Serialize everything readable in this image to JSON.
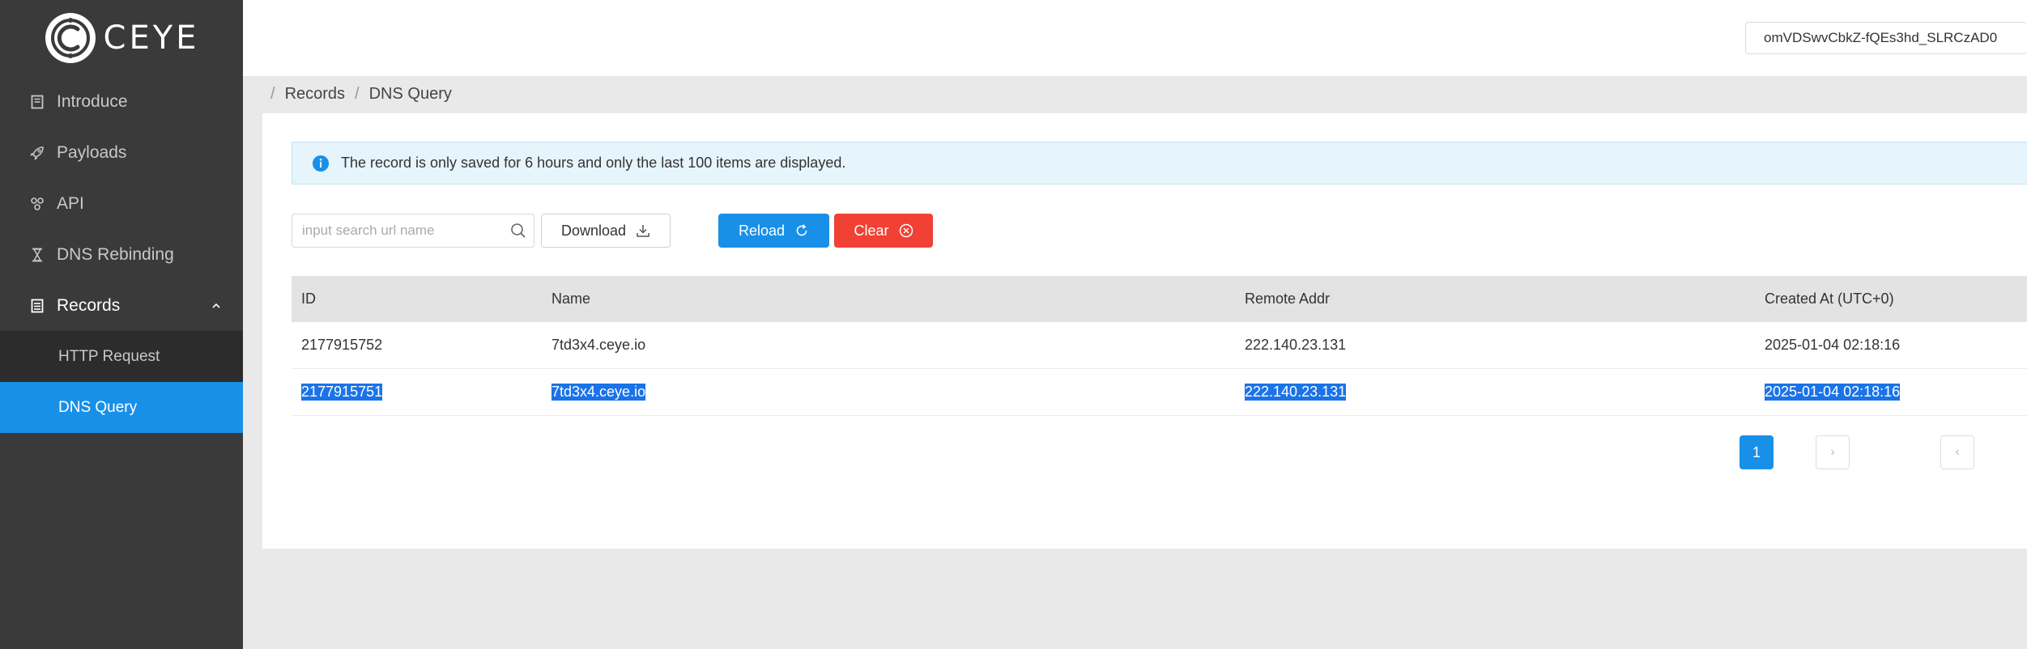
{
  "brand": {
    "name": "CEYE"
  },
  "sidebar": {
    "items": [
      {
        "label": "Introduce",
        "icon": "book-icon"
      },
      {
        "label": "Payloads",
        "icon": "rocket-icon"
      },
      {
        "label": "API",
        "icon": "api-icon"
      },
      {
        "label": "DNS Rebinding",
        "icon": "hourglass-icon"
      },
      {
        "label": "Records",
        "icon": "records-icon"
      }
    ],
    "submenu": [
      {
        "label": "HTTP Request"
      },
      {
        "label": "DNS Query"
      }
    ]
  },
  "header": {
    "account": "omVDSwvCbkZ-fQEs3hd_SLRCzAD0"
  },
  "breadcrumb": {
    "root": "Records",
    "current": "DNS Query"
  },
  "alert": {
    "text": "The record is only saved for 6 hours and only the last 100 items are displayed."
  },
  "toolbar": {
    "search_placeholder": "input search url name",
    "download_label": "Download",
    "reload_label": "Reload",
    "clear_label": "Clear"
  },
  "table": {
    "headers": {
      "id": "ID",
      "name": "Name",
      "addr": "Remote Addr",
      "created": "Created At (UTC+0)"
    },
    "rows": [
      {
        "id": "2177915752",
        "name": "7td3x4.ceye.io",
        "addr": "222.140.23.131",
        "created": "2025-01-04 02:18:16"
      },
      {
        "id": "2177915751",
        "name": "7td3x4.ceye.io",
        "addr": "222.140.23.131",
        "created": "2025-01-04 02:18:16"
      }
    ]
  },
  "pagination": {
    "current_page": "1",
    "prev": "‹",
    "next": "›"
  },
  "colors": {
    "primary": "#1890e8",
    "danger": "#f04134",
    "sidebar": "#3a3a3a",
    "selection": "#1a73e8"
  }
}
